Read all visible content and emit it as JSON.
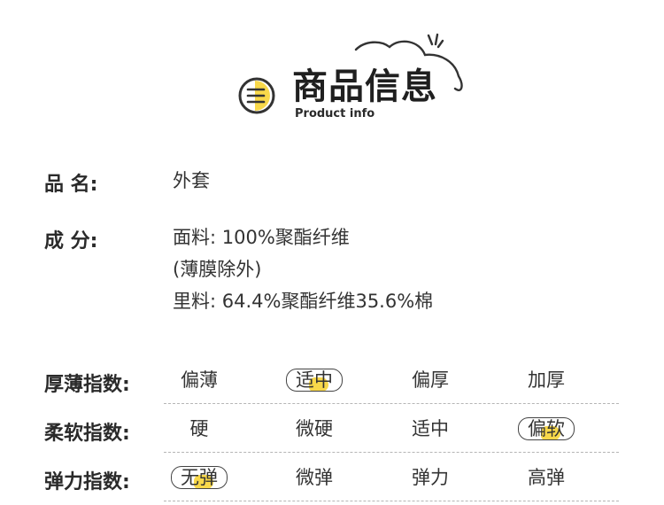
{
  "header": {
    "title": "商品信息",
    "subtitle": "Product info",
    "accent_color": "#f8d84a",
    "icons": [
      "menu-circle-icon",
      "cloud-icon"
    ]
  },
  "info": [
    {
      "label": "品    名:",
      "lines": [
        "外套"
      ]
    },
    {
      "label": "成    分:",
      "lines": [
        "面料: 100%聚酯纤维",
        "(薄膜除外)",
        "里料: 64.4%聚酯纤维35.6%棉"
      ]
    }
  ],
  "indices": [
    {
      "label": "厚薄指数:",
      "options": [
        "偏薄",
        "适中",
        "偏厚",
        "加厚"
      ],
      "selected": 1
    },
    {
      "label": "柔软指数:",
      "options": [
        "硬",
        "微硬",
        "适中",
        "偏软"
      ],
      "selected": 3
    },
    {
      "label": "弹力指数:",
      "options": [
        "无弹",
        "微弹",
        "弹力",
        "高弹"
      ],
      "selected": 0
    }
  ]
}
